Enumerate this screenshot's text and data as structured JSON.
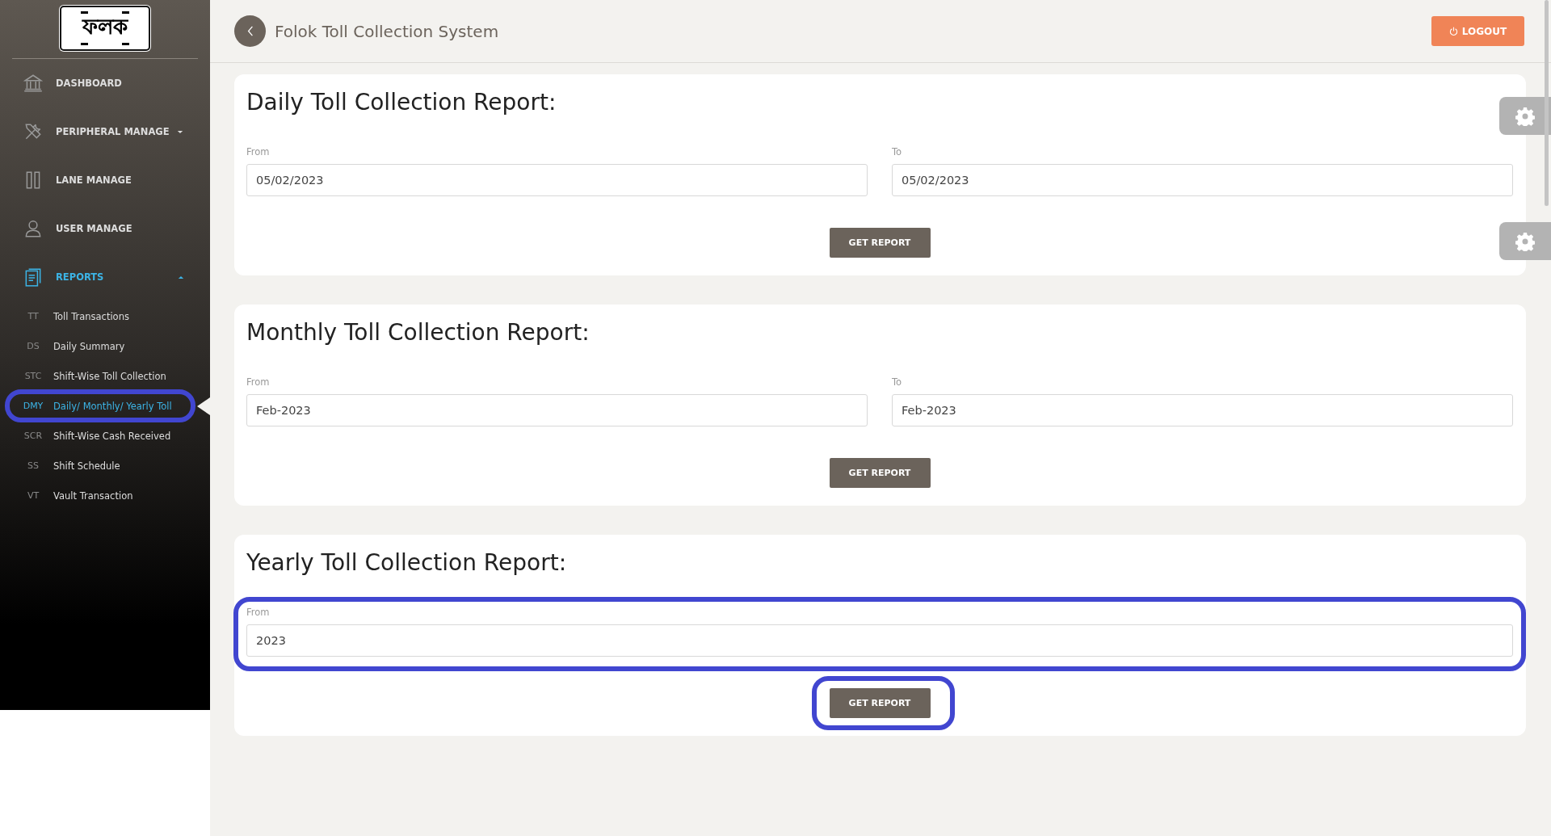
{
  "logo": {
    "text": "ফলক"
  },
  "sidebar": {
    "items": [
      {
        "label": "DASHBOARD",
        "selected": false
      },
      {
        "label": "PERIPHERAL MANAGE",
        "selected": false,
        "expanded": false
      },
      {
        "label": "LANE MANAGE",
        "selected": false
      },
      {
        "label": "USER MANAGE",
        "selected": false
      },
      {
        "label": "REPORTS",
        "selected": true,
        "expanded": true,
        "children": [
          {
            "abbr": "TT",
            "label": "Toll Transactions",
            "selected": false
          },
          {
            "abbr": "DS",
            "label": "Daily Summary",
            "selected": false
          },
          {
            "abbr": "STC",
            "label": "Shift-Wise Toll Collection",
            "selected": false
          },
          {
            "abbr": "DMY",
            "label": "Daily/ Monthly/ Yearly Toll",
            "selected": true,
            "highlighted": true
          },
          {
            "abbr": "SCR",
            "label": "Shift-Wise Cash Received",
            "selected": false
          },
          {
            "abbr": "SS",
            "label": "Shift Schedule",
            "selected": false
          },
          {
            "abbr": "VT",
            "label": "Vault Transaction",
            "selected": false
          }
        ]
      }
    ]
  },
  "header": {
    "title": "Folok Toll Collection System",
    "logout": "LOGOUT"
  },
  "reports": [
    {
      "title": "Daily Toll Collection Report:",
      "fields": [
        {
          "label": "From",
          "value": "05/02/2023"
        },
        {
          "label": "To",
          "value": "05/02/2023"
        }
      ],
      "button": "GET REPORT"
    },
    {
      "title": "Monthly Toll Collection Report:",
      "fields": [
        {
          "label": "From",
          "value": "Feb-2023"
        },
        {
          "label": "To",
          "value": "Feb-2023"
        }
      ],
      "button": "GET REPORT"
    },
    {
      "title": "Yearly Toll Collection Report:",
      "fields": [
        {
          "label": "From",
          "value": "2023"
        }
      ],
      "button": "GET REPORT",
      "fields_highlighted": true,
      "button_highlighted": true
    }
  ]
}
